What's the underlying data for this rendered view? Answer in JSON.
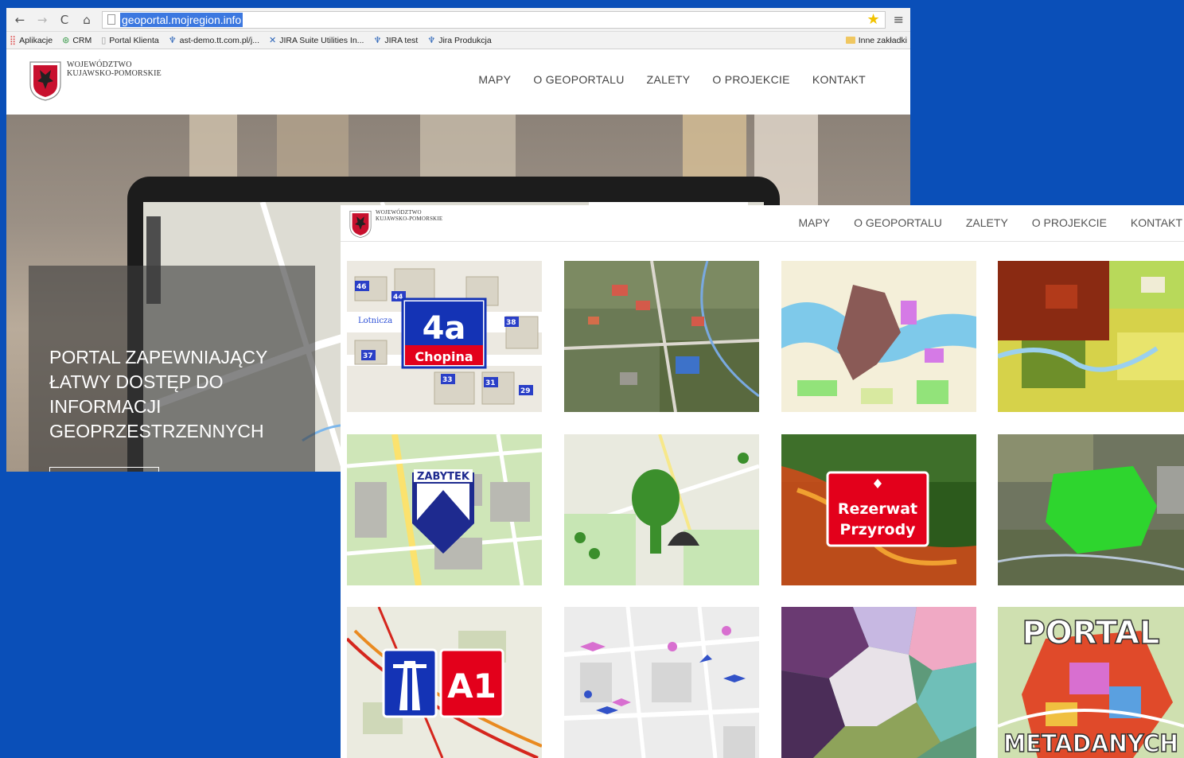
{
  "browser": {
    "nav": {
      "back": "←",
      "forward": "→",
      "reload": "C",
      "home": "⌂"
    },
    "url": "geoportal.mojregion.info",
    "bookmarks": [
      {
        "icon": "apps-grid-icon",
        "label": "Aplikacje"
      },
      {
        "icon": "crm-icon",
        "label": "CRM"
      },
      {
        "icon": "page-icon",
        "label": "Portal Klienta"
      },
      {
        "icon": "jira-icon",
        "label": "ast-demo.tt.com.pl/j..."
      },
      {
        "icon": "jira-suite-icon",
        "label": "JIRA Suite Utilities In..."
      },
      {
        "icon": "jira-icon",
        "label": "JIRA test"
      },
      {
        "icon": "jira-icon",
        "label": "Jira Produkcja"
      }
    ],
    "other_bookmarks": "Inne zakładki"
  },
  "site": {
    "logo_line1": "WOJEWÓDZTWO",
    "logo_line2": "KUJAWSKO-POMORSKIE",
    "nav": [
      "MAPY",
      "O GEOPORTALU",
      "ZALETY",
      "O PROJEKCIE",
      "KONTAKT"
    ],
    "hero_title": "PORTAL ZAPEWNIAJĄCY ŁATWY DOSTĘP DO INFORMACJI GEOPRZESTRZENNYCH"
  },
  "front": {
    "logo_line1": "WOJEWÓDZTWO",
    "logo_line2": "KUJAWSKO-POMORSKIE",
    "nav": [
      "MAPY",
      "O GEOPORTALU",
      "ZALETY",
      "O PROJEKCIE",
      "KONTAKT"
    ],
    "tiles": {
      "address": {
        "big": "4a",
        "street": "Chopina",
        "road": "Lotnicza",
        "numbers": [
          "46",
          "44",
          "38",
          "37",
          "33",
          "31",
          "29"
        ]
      },
      "monument": {
        "label": "ZABYTEK"
      },
      "reserve": {
        "line1": "Rezerwat",
        "line2": "Przyrody"
      },
      "motorway": {
        "label": "A1"
      },
      "portal": {
        "line1": "PORTAL",
        "line2": "METADANYCH"
      }
    }
  },
  "colors": {
    "background": "#0a4fb8",
    "accent_red": "#e3001b",
    "road_sign_blue": "#1433b5"
  }
}
